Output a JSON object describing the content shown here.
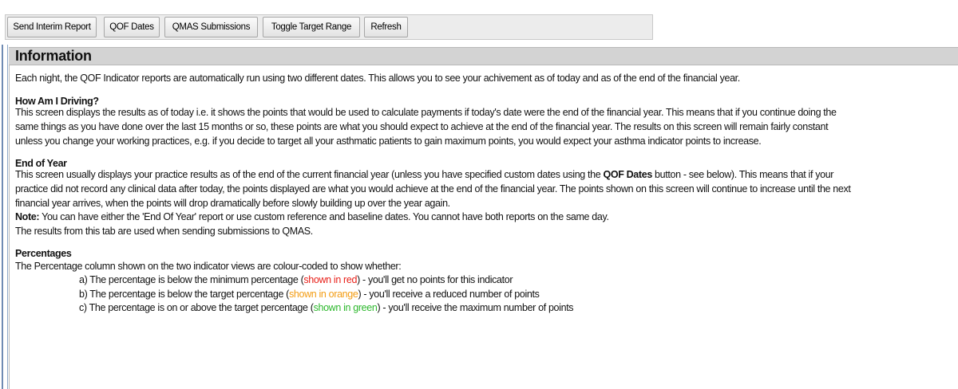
{
  "toolbar": {
    "buttons": [
      {
        "label": "Send Interim Report"
      },
      {
        "label": "QOF Dates"
      },
      {
        "label": "QMAS Submissions"
      },
      {
        "label": "Toggle Target Range"
      },
      {
        "label": "Refresh"
      }
    ]
  },
  "panel": {
    "title": "Information",
    "intro": "Each night, the QOF Indicator reports are automatically run using two different dates. This allows you to see your achivement as of today and as of the end of the financial year.",
    "how_driving": {
      "heading": "How Am I Driving?",
      "lines": [
        "This screen displays the results as of today i.e. it shows the points that would be used to calculate payments if today's date were the end of the financial year. This means that if you continue doing the",
        "same things as you have done over the last 15 months or so, these points are what you should expect to achieve at the end of the financial year. The results on this screen will remain fairly constant",
        "unless you change your working practices, e.g. if you decide to target all your asthmatic patients to gain maximum points, you would expect your asthma indicator points to increase."
      ]
    },
    "end_of_year": {
      "heading": "End of Year",
      "line1_pre": "This screen usually displays your practice results as of the end of the current financial year (unless you have specified custom dates using the ",
      "line1_bold": "QOF Dates",
      "line1_post": " button - see below). This means that if your",
      "line2": "practice did not record any clinical data after today, the points displayed are what you would achieve at the end of the financial year. The points shown on this screen will continue to increase until the next",
      "line3": "financial year arrives, when the points will drop dramatically before slowly building up over the year again.",
      "note_label": "Note:",
      "note_text": " You can have either the 'End Of Year' report or use custom reference and baseline dates. You cannot have both reports on the same day.",
      "line5": "The results from this tab are used when sending submissions to QMAS."
    },
    "percentages": {
      "heading": "Percentages",
      "intro": "The Percentage column shown on the two indicator views are colour-coded to show whether:",
      "items": [
        {
          "pre": "a) The percentage is below the minimum percentage (",
          "colored": "shown in red",
          "post": ") - you'll get no points for this indicator",
          "color": "#e8211a"
        },
        {
          "pre": "b) The percentage is below the target percentage (",
          "colored": "shown in orange",
          "post": ") - you'll receive a reduced number of points",
          "color": "#f39c12"
        },
        {
          "pre": "c) The percentage is on or above the target percentage (",
          "colored": "shown in green",
          "post": ") - you'll receive the maximum number of points",
          "color": "#2db82d"
        }
      ]
    }
  }
}
